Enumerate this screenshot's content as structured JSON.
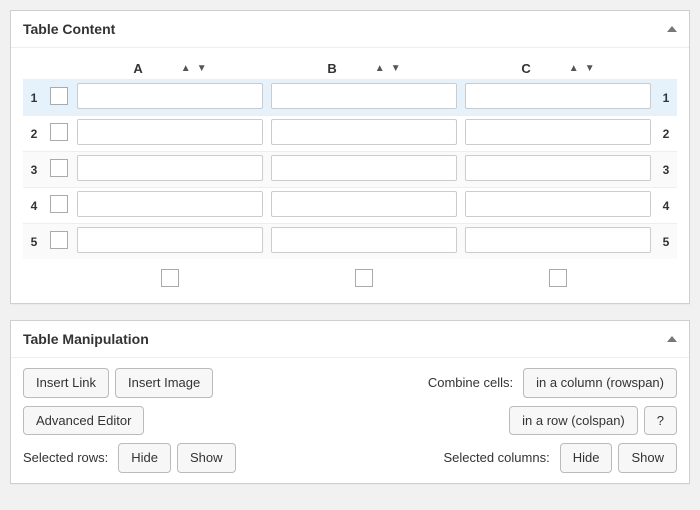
{
  "tableContent": {
    "title": "Table Content",
    "columns": [
      "A",
      "B",
      "C"
    ],
    "rows": [
      {
        "num": "1",
        "cells": [
          "",
          "",
          ""
        ],
        "selected": true
      },
      {
        "num": "2",
        "cells": [
          "",
          "",
          ""
        ],
        "selected": false
      },
      {
        "num": "3",
        "cells": [
          "",
          "",
          ""
        ],
        "selected": false
      },
      {
        "num": "4",
        "cells": [
          "",
          "",
          ""
        ],
        "selected": false
      },
      {
        "num": "5",
        "cells": [
          "",
          "",
          ""
        ],
        "selected": false
      }
    ]
  },
  "tableManipulation": {
    "title": "Table Manipulation",
    "insertLink": "Insert Link",
    "insertImage": "Insert Image",
    "advancedEditor": "Advanced Editor",
    "combineCellsLabel": "Combine cells:",
    "rowspanBtn": "in a column (rowspan)",
    "colspanBtn": "in a row (colspan)",
    "helpBtn": "?",
    "selectedRowsLabel": "Selected rows:",
    "selectedColsLabel": "Selected columns:",
    "hide": "Hide",
    "show": "Show"
  }
}
